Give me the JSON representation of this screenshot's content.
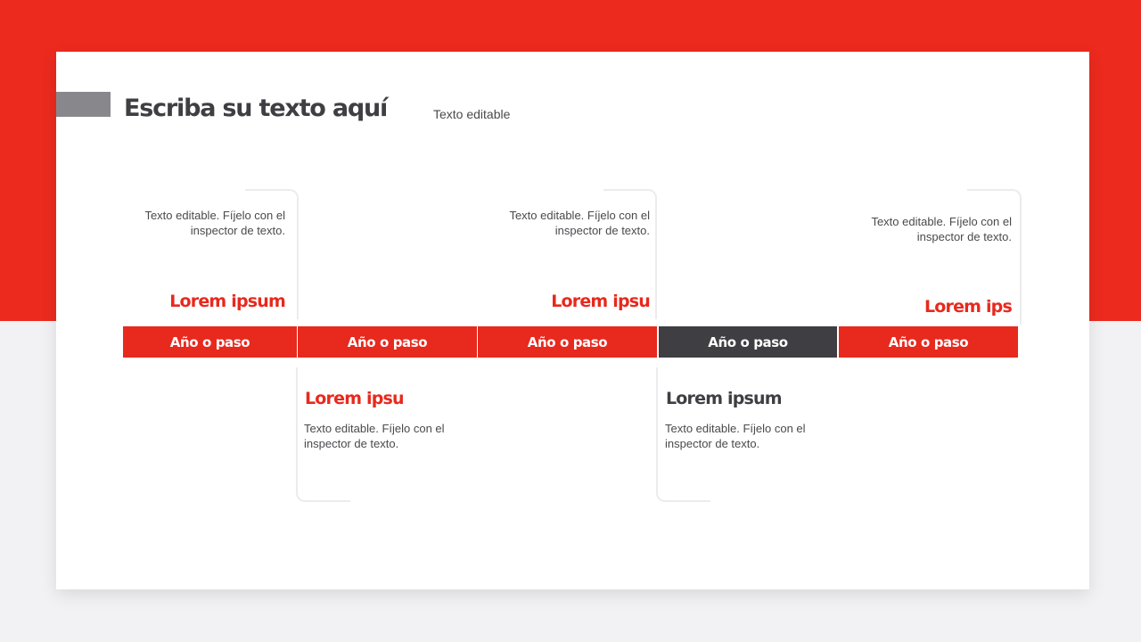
{
  "slide": {
    "title": "Escriba su texto aquí",
    "subtitle": "Texto editable"
  },
  "colors": {
    "accent": "#e8291e",
    "dark": "#3f3e42",
    "background_top": "#ec2a1e",
    "background_bottom": "#f2f1f4"
  },
  "timeline": {
    "steps": [
      {
        "label": "Año o paso",
        "highlighted": false
      },
      {
        "label": "Año o paso",
        "highlighted": false
      },
      {
        "label": "Año o paso",
        "highlighted": false
      },
      {
        "label": "Año o paso",
        "highlighted": true
      },
      {
        "label": "Año o paso",
        "highlighted": false
      }
    ],
    "items": [
      {
        "heading": "Lorem ipsum",
        "text": "Texto editable. Fíjelo con el inspector de texto.",
        "position": "above"
      },
      {
        "heading": "Lorem ipsu",
        "text": "Texto editable. Fíjelo con el inspector de texto.",
        "position": "below"
      },
      {
        "heading": "Lorem ipsu",
        "text": "Texto editable. Fíjelo con el inspector de texto.",
        "position": "above"
      },
      {
        "heading": "Lorem ipsum",
        "text": "Texto editable. Fíjelo con el inspector de texto.",
        "position": "below"
      },
      {
        "heading": "Lorem ips",
        "text": "Texto editable. Fíjelo con el inspector de texto.",
        "position": "above"
      }
    ]
  }
}
